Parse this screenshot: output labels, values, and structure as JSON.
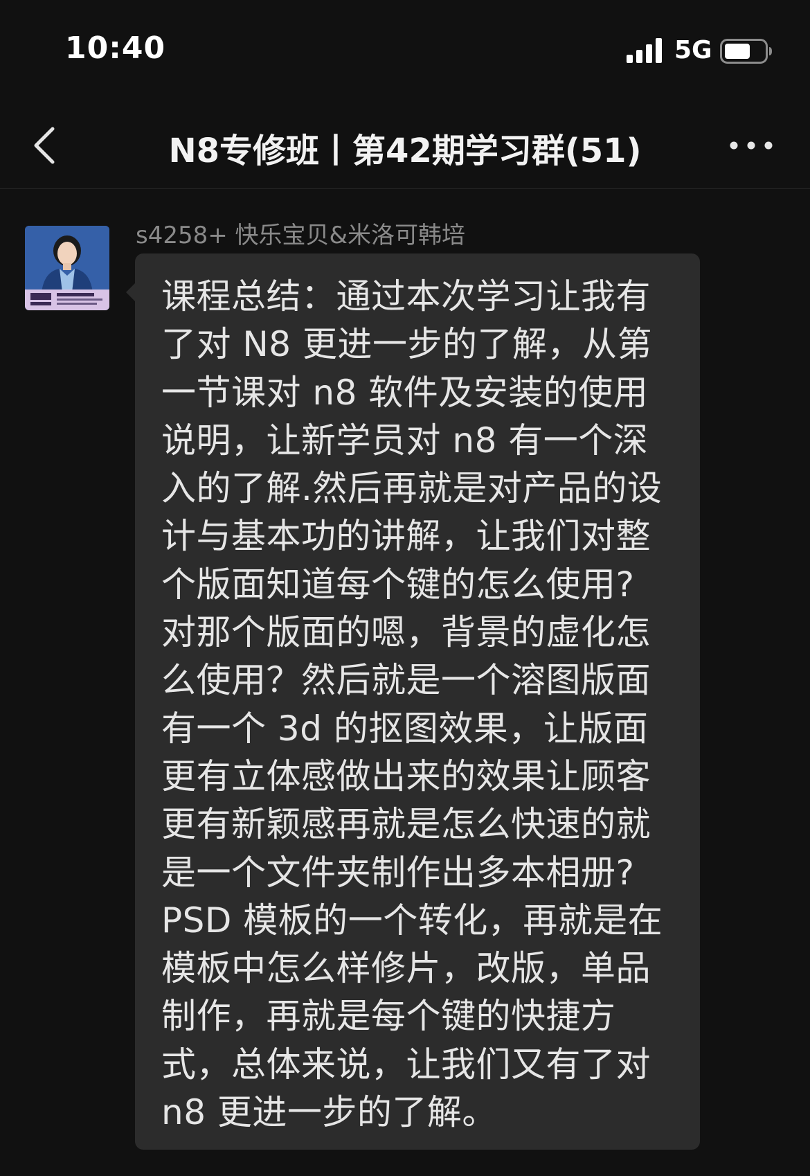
{
  "status_bar": {
    "time": "10:40",
    "network": "5G",
    "icons": [
      "signal-icon",
      "battery-icon"
    ]
  },
  "nav": {
    "title": "N8专修班丨第42期学习群(51)",
    "icons": [
      "back-icon",
      "more-icon"
    ]
  },
  "message": {
    "sender": "s4258+ 快乐宝贝&米洛可韩培",
    "avatar_icon": "avatar-photo",
    "lines": [
      "课程总结：通过本次学习让我有",
      "了对 N8 更进一步的了解，从第",
      "一节课对 n8 软件及安装的使用",
      "说明，让新学员对 n8 有一个深",
      "入的了解.然后再就是对产品的设",
      "计与基本功的讲解，让我们对整",
      "个版面知道每个键的怎么使用?",
      "对那个版面的嗯，背景的虚化怎",
      "么使用？然后就是一个溶图版面",
      "有一个 3d 的抠图效果，让版面",
      "更有立体感做出来的效果让顾客",
      "更有新颖感再就是怎么快速的就",
      "是一个文件夹制作出多本相册?",
      "PSD 模板的一个转化，再就是在",
      "模板中怎么样修片，改版，单品",
      "制作，再就是每个键的快捷方",
      "式，总体来说，让我们又有了对",
      "n8 更进一步的了解。"
    ]
  },
  "colors": {
    "background": "#111111",
    "bubble": "#2c2c2c",
    "sender_name": "#8a8a8a",
    "text": "#e6e6e6"
  }
}
